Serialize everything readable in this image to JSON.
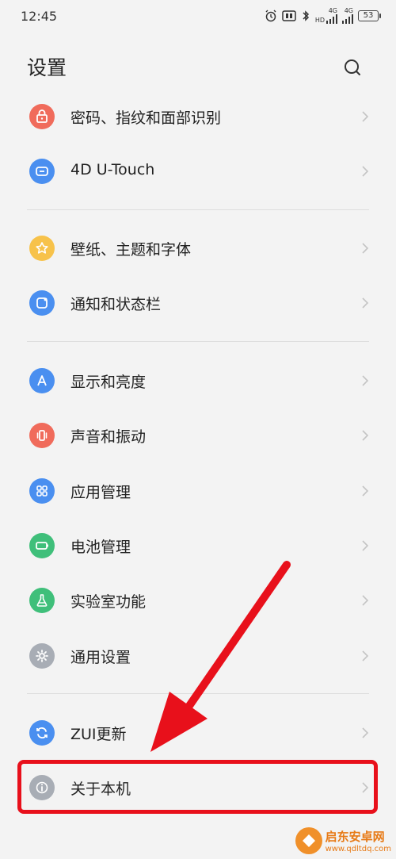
{
  "status_bar": {
    "time": "12:45",
    "network_1": "4G",
    "network_1_sub": "HD",
    "network_2": "4G",
    "battery": "53"
  },
  "header": {
    "title": "设置"
  },
  "settings": [
    {
      "label": "密码、指纹和面部识别",
      "icon": "lock-icon",
      "color": "#f06b5b"
    },
    {
      "label": "4D U-Touch",
      "icon": "touch-icon",
      "color": "#4a8ff0"
    },
    {
      "label": "壁纸、主题和字体",
      "icon": "star-icon",
      "color": "#f7c24a"
    },
    {
      "label": "通知和状态栏",
      "icon": "notification-icon",
      "color": "#4a8ff0"
    },
    {
      "label": "显示和亮度",
      "icon": "display-icon",
      "color": "#4a8ff0"
    },
    {
      "label": "声音和振动",
      "icon": "vibrate-icon",
      "color": "#f06b5b"
    },
    {
      "label": "应用管理",
      "icon": "apps-icon",
      "color": "#4a8ff0"
    },
    {
      "label": "电池管理",
      "icon": "battery-icon",
      "color": "#3fbf7a"
    },
    {
      "label": "实验室功能",
      "icon": "flask-icon",
      "color": "#3fbf7a"
    },
    {
      "label": "通用设置",
      "icon": "gear-icon",
      "color": "#a8adb5"
    },
    {
      "label": "ZUI更新",
      "icon": "update-icon",
      "color": "#4a8ff0"
    },
    {
      "label": "关于本机",
      "icon": "info-icon",
      "color": "#a8adb5"
    }
  ],
  "annotation": {
    "highlight_color": "#e8101b"
  },
  "watermark": {
    "name": "启东安卓网",
    "url": "www.qdltdq.com"
  }
}
